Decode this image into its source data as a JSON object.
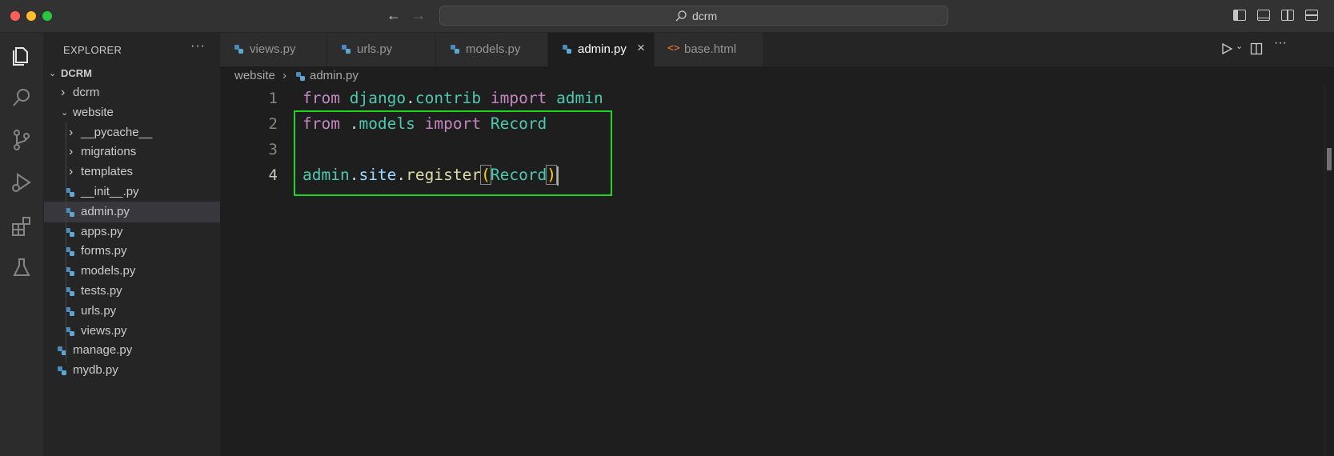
{
  "window": {
    "title": "dcrm"
  },
  "explorer": {
    "header": "EXPLORER",
    "more_label": "···",
    "root": "DCRM",
    "items": [
      {
        "label": "dcrm",
        "kind": "folder",
        "expanded": false,
        "depth": 1
      },
      {
        "label": "website",
        "kind": "folder",
        "expanded": true,
        "depth": 1
      },
      {
        "label": "__pycache__",
        "kind": "folder",
        "expanded": false,
        "depth": 2
      },
      {
        "label": "migrations",
        "kind": "folder",
        "expanded": false,
        "depth": 2
      },
      {
        "label": "templates",
        "kind": "folder",
        "expanded": false,
        "depth": 2
      },
      {
        "label": "__init__.py",
        "kind": "python",
        "depth": 2
      },
      {
        "label": "admin.py",
        "kind": "python",
        "depth": 2,
        "selected": true
      },
      {
        "label": "apps.py",
        "kind": "python",
        "depth": 2
      },
      {
        "label": "forms.py",
        "kind": "python",
        "depth": 2
      },
      {
        "label": "models.py",
        "kind": "python",
        "depth": 2
      },
      {
        "label": "tests.py",
        "kind": "python",
        "depth": 2
      },
      {
        "label": "urls.py",
        "kind": "python",
        "depth": 2
      },
      {
        "label": "views.py",
        "kind": "python",
        "depth": 2
      },
      {
        "label": "manage.py",
        "kind": "python",
        "depth": 1
      },
      {
        "label": "mydb.py",
        "kind": "python",
        "depth": 1
      }
    ]
  },
  "tabs": [
    {
      "label": "views.py",
      "kind": "python",
      "active": false
    },
    {
      "label": "urls.py",
      "kind": "python",
      "active": false
    },
    {
      "label": "models.py",
      "kind": "python",
      "active": false
    },
    {
      "label": "admin.py",
      "kind": "python",
      "active": true
    },
    {
      "label": "base.html",
      "kind": "html",
      "active": false
    }
  ],
  "tab_close_label": "×",
  "breadcrumb": {
    "folder": "website",
    "separator": "›",
    "file": "admin.py"
  },
  "editor": {
    "line_numbers": [
      "1",
      "2",
      "3",
      "4"
    ],
    "active_line": 4,
    "lines": [
      [
        {
          "t": "from",
          "c": "kw"
        },
        {
          "t": " ",
          "c": "plain"
        },
        {
          "t": "django",
          "c": "mod"
        },
        {
          "t": ".",
          "c": "plain"
        },
        {
          "t": "contrib",
          "c": "mod"
        },
        {
          "t": " ",
          "c": "plain"
        },
        {
          "t": "import",
          "c": "kw"
        },
        {
          "t": " ",
          "c": "plain"
        },
        {
          "t": "admin",
          "c": "mod"
        }
      ],
      [
        {
          "t": "from",
          "c": "kw"
        },
        {
          "t": " .",
          "c": "plain"
        },
        {
          "t": "models",
          "c": "mod"
        },
        {
          "t": " ",
          "c": "plain"
        },
        {
          "t": "import",
          "c": "kw"
        },
        {
          "t": " ",
          "c": "plain"
        },
        {
          "t": "Record",
          "c": "mod"
        }
      ],
      [],
      [
        {
          "t": "admin",
          "c": "mod"
        },
        {
          "t": ".",
          "c": "plain"
        },
        {
          "t": "site",
          "c": "var"
        },
        {
          "t": ".",
          "c": "plain"
        },
        {
          "t": "register",
          "c": "fn"
        },
        {
          "t": "(",
          "c": "brk"
        },
        {
          "t": "Record",
          "c": "mod"
        },
        {
          "t": ")",
          "c": "brk"
        }
      ]
    ]
  },
  "colors": {
    "highlight_box": "#1fd41f",
    "keyword": "#c586c0",
    "module": "#4ec9b0",
    "function": "#dcdcaa",
    "property": "#9cdcfe"
  }
}
